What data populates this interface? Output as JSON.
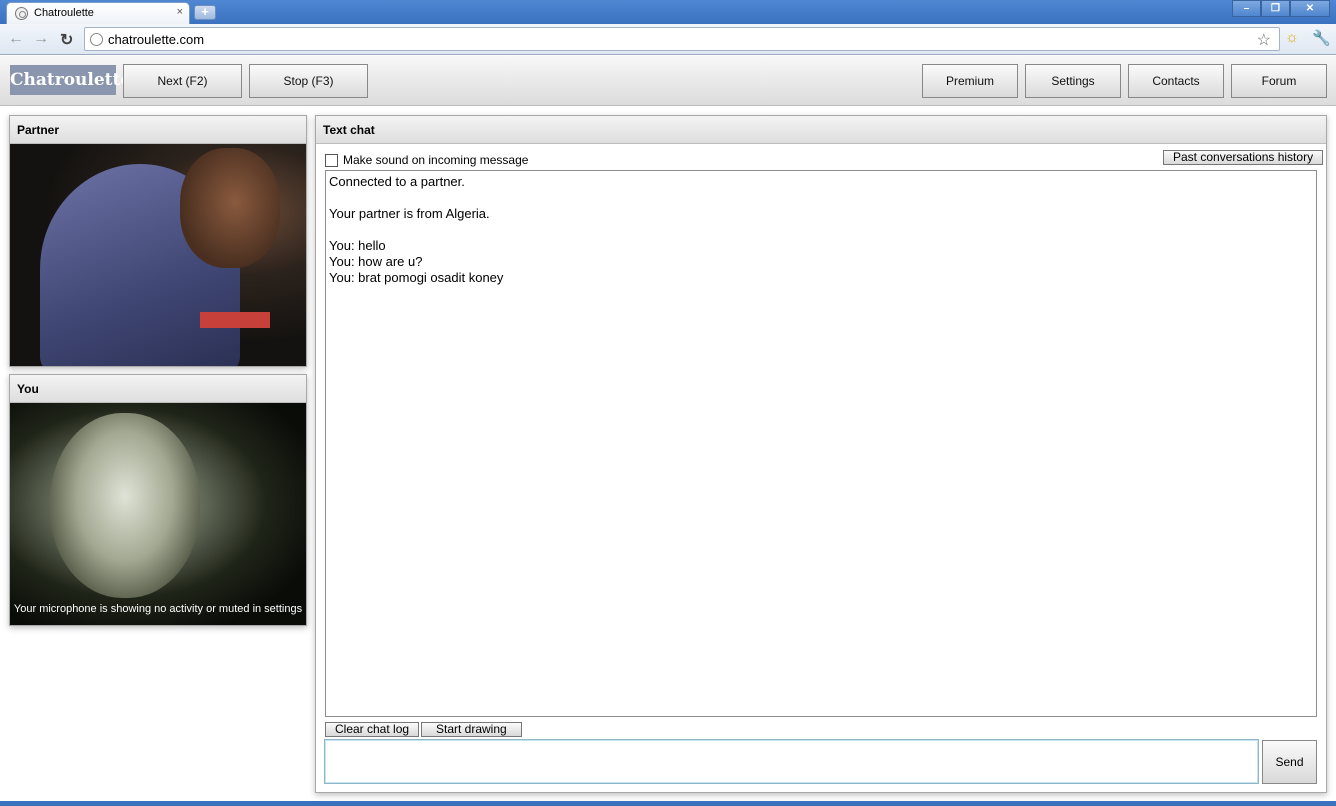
{
  "browser": {
    "tab_title": "Chatroulette",
    "tab_close": "×",
    "new_tab": "+",
    "url": "chatroulette.com",
    "window_buttons": {
      "minimize": "–",
      "restore": "❐",
      "close": "✕"
    }
  },
  "header": {
    "logo": "Chatroulette",
    "next_label": "Next (F2)",
    "stop_label": "Stop (F3)",
    "premium_label": "Premium",
    "settings_label": "Settings",
    "contacts_label": "Contacts",
    "forum_label": "Forum"
  },
  "partner_panel": {
    "title": "Partner"
  },
  "you_panel": {
    "title": "You",
    "mic_note": "Your microphone is showing no activity or muted in settings"
  },
  "text_chat": {
    "title": "Text chat",
    "sound_option": "Make sound on incoming message",
    "history_button": "Past conversations history",
    "log": [
      "Connected to a partner.",
      "",
      "Your partner is from Algeria.",
      "",
      "You: hello",
      "You: how are u?",
      "You: brat pomogi osadit koney"
    ],
    "clear_button": "Clear chat log",
    "drawing_button": "Start drawing",
    "input_value": "",
    "send_button": "Send"
  }
}
